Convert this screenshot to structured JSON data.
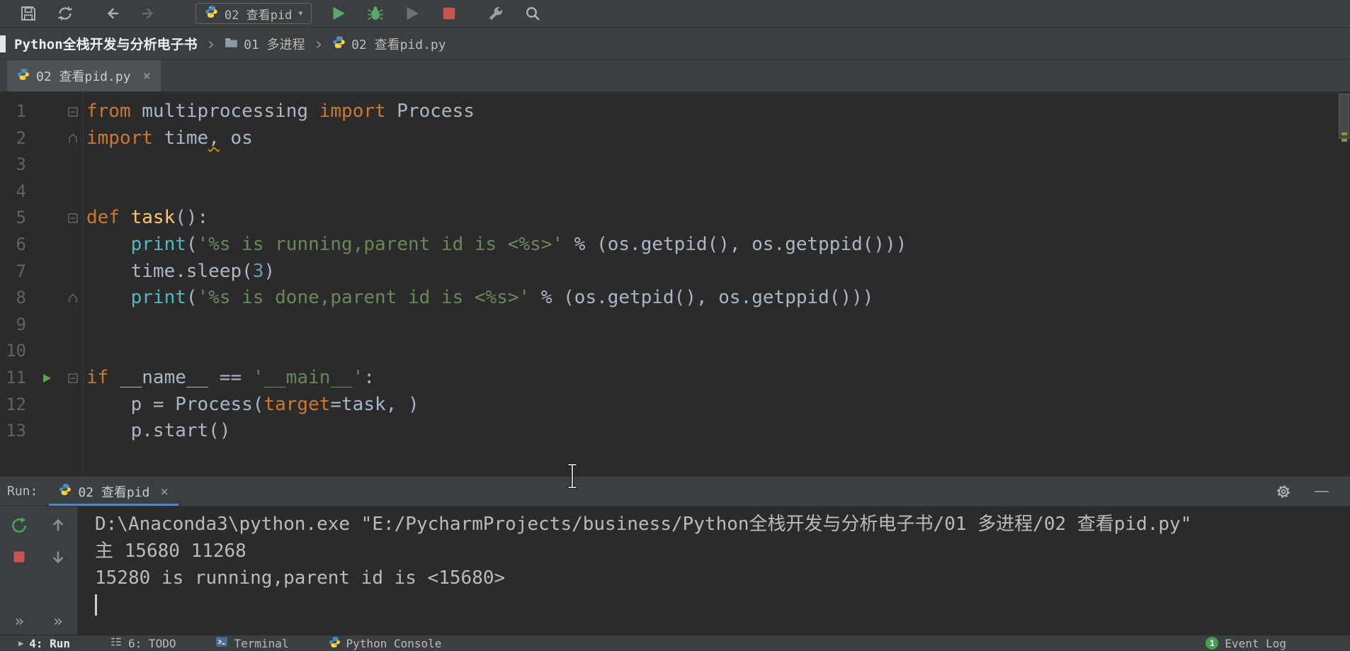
{
  "icons": {
    "close": "×",
    "chevron_sep": "›",
    "dropdown_caret": "▼",
    "double_chevron": "»",
    "minimize": "—",
    "play_marker": "▶"
  },
  "toolbar": {
    "run_config": "02 查看pid"
  },
  "breadcrumb": {
    "items": [
      "Python全栈开发与分析电子书",
      "01 多进程",
      "02 查看pid.py"
    ]
  },
  "editor_tab": {
    "title": "02 查看pid.py"
  },
  "editor": {
    "lines": [
      {
        "n": "1",
        "fold": "start",
        "tokens": [
          [
            "kw",
            "from"
          ],
          [
            "t",
            " multiprocessing "
          ],
          [
            "kw",
            "import"
          ],
          [
            "t",
            " Process"
          ]
        ]
      },
      {
        "n": "2",
        "fold": "end",
        "tokens": [
          [
            "kw",
            "import"
          ],
          [
            "t",
            " time"
          ],
          [
            "warn",
            ","
          ],
          [
            "t",
            " os"
          ]
        ]
      },
      {
        "n": "3",
        "tokens": []
      },
      {
        "n": "4",
        "tokens": []
      },
      {
        "n": "5",
        "fold": "start",
        "tokens": [
          [
            "kw",
            "def"
          ],
          [
            "t",
            " "
          ],
          [
            "fn",
            "task"
          ],
          [
            "t",
            "():"
          ]
        ]
      },
      {
        "n": "6",
        "tokens": [
          [
            "t",
            "    "
          ],
          [
            "bi",
            "print"
          ],
          [
            "t",
            "("
          ],
          [
            "str",
            "'%s is running,parent id is <%s>'"
          ],
          [
            "t",
            " % (os.getpid(), os.getppid()))"
          ]
        ]
      },
      {
        "n": "7",
        "tokens": [
          [
            "t",
            "    time.sleep("
          ],
          [
            "num",
            "3"
          ],
          [
            "t",
            ")"
          ]
        ]
      },
      {
        "n": "8",
        "fold": "end",
        "tokens": [
          [
            "t",
            "    "
          ],
          [
            "bi",
            "print"
          ],
          [
            "t",
            "("
          ],
          [
            "str",
            "'%s is done,parent id is <%s>'"
          ],
          [
            "t",
            " % (os.getpid(), os.getppid()))"
          ]
        ]
      },
      {
        "n": "9",
        "tokens": []
      },
      {
        "n": "10",
        "tokens": []
      },
      {
        "n": "11",
        "fold": "start",
        "run": true,
        "tokens": [
          [
            "kw",
            "if"
          ],
          [
            "t",
            " __name__ == "
          ],
          [
            "str",
            "'__main__'"
          ],
          [
            "t",
            ":"
          ]
        ]
      },
      {
        "n": "12",
        "tokens": [
          [
            "t",
            "    p = Process("
          ],
          [
            "arg",
            "target"
          ],
          [
            "t",
            "=task, )"
          ]
        ]
      },
      {
        "n": "13",
        "tokens": [
          [
            "t",
            "    p.start()"
          ]
        ]
      }
    ]
  },
  "run_panel": {
    "label": "Run:",
    "tab": "02 查看pid",
    "console": [
      "D:\\Anaconda3\\python.exe \"E:/PycharmProjects/business/Python全栈开发与分析电子书/01 多进程/02 查看pid.py\"",
      "主 15680 11268",
      "15280 is running,parent id is <15680>"
    ]
  },
  "status_bar": {
    "items": [
      "4: Run",
      "6: TODO",
      "Terminal",
      "Python Console"
    ],
    "event_log_label": "Event Log",
    "event_count": "1"
  },
  "colors": {
    "keyword": "#CC7832",
    "string": "#6A8759",
    "number": "#6897BB",
    "function_name": "#FFC66D",
    "builtin": "#56B6C2",
    "run_green": "#499C54",
    "stop_red": "#C75450",
    "editor_bg": "#2B2B2B",
    "panel_bg": "#3C3F41"
  }
}
